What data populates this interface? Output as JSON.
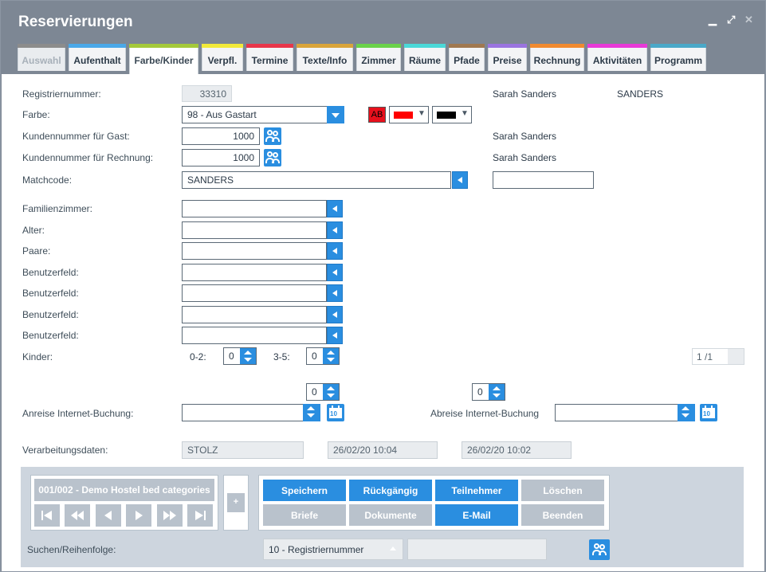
{
  "window": {
    "title": "Reservierungen",
    "minimize": "▁",
    "maximize": "⤢",
    "close": "✕"
  },
  "tabs": [
    {
      "label": "Auswahl",
      "color": "#8c8c8c"
    },
    {
      "label": "Aufenthalt",
      "color": "#4aa8e8"
    },
    {
      "label": "Farbe/Kinder",
      "color": "#a4c93a"
    },
    {
      "label": "Verpfl.",
      "color": "#f2ea3a"
    },
    {
      "label": "Termine",
      "color": "#e8364a"
    },
    {
      "label": "Texte/Info",
      "color": "#d9a43a"
    },
    {
      "label": "Zimmer",
      "color": "#6ad24a"
    },
    {
      "label": "Räume",
      "color": "#4ad8d8"
    },
    {
      "label": "Pfade",
      "color": "#a07850"
    },
    {
      "label": "Preise",
      "color": "#9a74e0"
    },
    {
      "label": "Rechnung",
      "color": "#f08a30"
    },
    {
      "label": "Aktivitäten",
      "color": "#e83ad8"
    },
    {
      "label": "Programm",
      "color": "#4aa8c8"
    }
  ],
  "form": {
    "registriernummer": {
      "label": "Registriernummer:",
      "value": "33310"
    },
    "header_name": "Sarah Sanders",
    "header_matchcode": "SANDERS",
    "farbe": {
      "label": "Farbe:",
      "value": "98 - Aus Gastart",
      "ab_label": "AB",
      "color_fg": "#ff0000",
      "color_bg": "#000000"
    },
    "kundennummer_gast": {
      "label": "Kundennummer für Gast:",
      "value": "1000",
      "name": "Sarah Sanders"
    },
    "kundennummer_rechnung": {
      "label": "Kundennummer für Rechnung:",
      "value": "1000",
      "name": "Sarah Sanders"
    },
    "matchcode": {
      "label": "Matchcode:",
      "value": "SANDERS",
      "extra": ""
    },
    "familienzimmer": {
      "label": "Familienzimmer:",
      "value": ""
    },
    "alter": {
      "label": "Alter:",
      "value": ""
    },
    "paare": {
      "label": "Paare:",
      "value": ""
    },
    "benutzerfelder": [
      {
        "label": "Benutzerfeld:",
        "value": ""
      },
      {
        "label": "Benutzerfeld:",
        "value": ""
      },
      {
        "label": "Benutzerfeld:",
        "value": ""
      },
      {
        "label": "Benutzerfeld:",
        "value": ""
      }
    ],
    "kinder": {
      "label": "Kinder:",
      "age1_label": "0-2:",
      "age1_value": "0",
      "age2_label": "3-5:",
      "age2_value": "0",
      "pager": "1 /1"
    },
    "spin_a": "0",
    "spin_b": "0",
    "anreise": {
      "label": "Anreise Internet-Buchung:",
      "value": ""
    },
    "abreise": {
      "label": "Abreise Internet-Buchung",
      "value": ""
    },
    "verarbeitung": {
      "label": "Verarbeitungsdaten:",
      "user": "STOLZ",
      "date1": "26/02/20 10:04",
      "date2": "26/02/20 10:02"
    }
  },
  "footer": {
    "record": "001/002 - Demo Hostel bed categories",
    "plus": "+",
    "buttons": {
      "speichern": "Speichern",
      "rueckgaengig": "Rückgängig",
      "teilnehmer": "Teilnehmer",
      "loeschen": "Löschen",
      "briefe": "Briefe",
      "dokumente": "Dokumente",
      "email": "E-Mail",
      "beenden": "Beenden"
    },
    "search_label": "Suchen/Reihenfolge:",
    "search_order": "10 - Registriernummer",
    "search_value": ""
  }
}
